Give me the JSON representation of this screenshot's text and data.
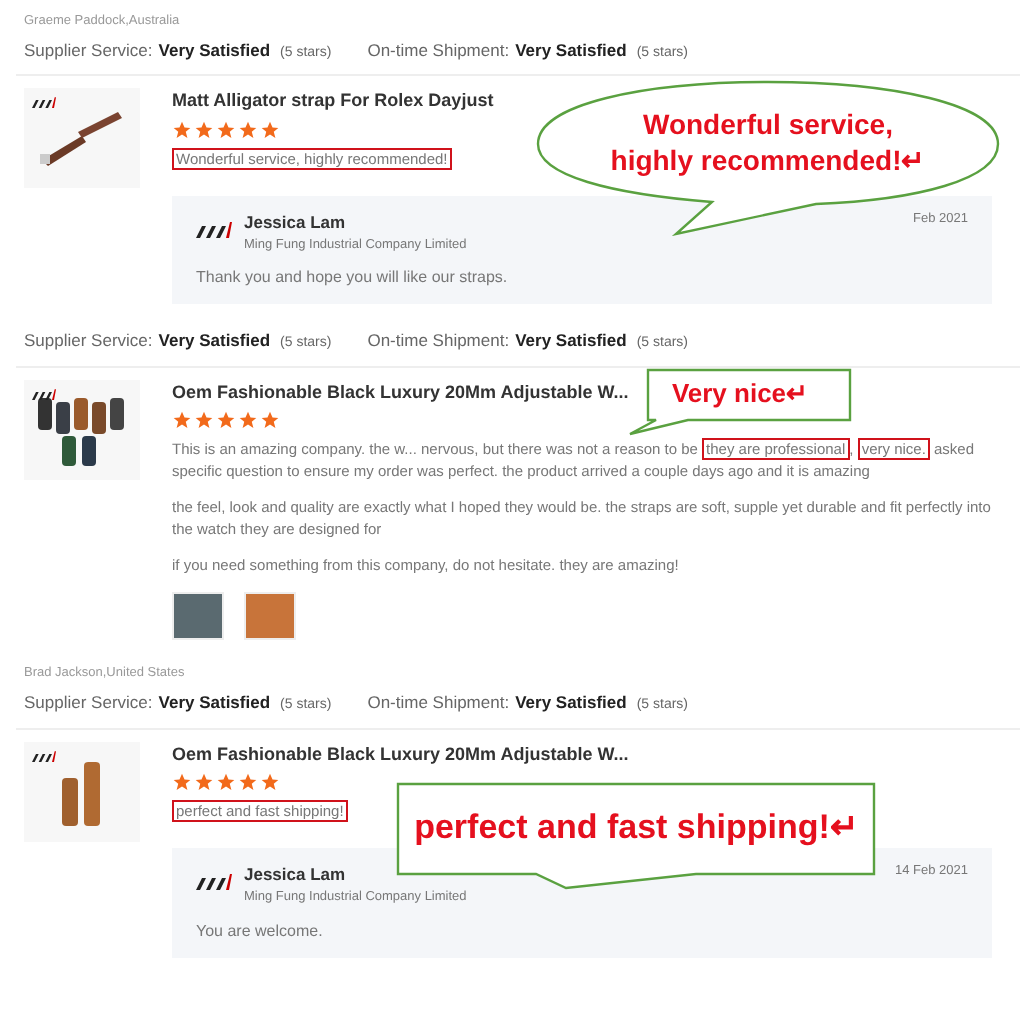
{
  "reviews": [
    {
      "reviewer": "Graeme Paddock,Australia",
      "ratings": [
        {
          "label": "Supplier Service:",
          "value": "Very Satisfied",
          "stars_text": "(5 stars)"
        },
        {
          "label": "On-time Shipment:",
          "value": "Very Satisfied",
          "stars_text": "(5 stars)"
        }
      ],
      "product": {
        "image": {
          "kind": "brown-strap"
        },
        "title": "Matt Alligator strap For Rolex Dayjust",
        "stars": 5,
        "comment": [
          [
            {
              "text": "Wonderful service, highly recommended!",
              "highlighted": true
            }
          ]
        ],
        "callout": {
          "kind": "ellipse",
          "lines": [
            "Wonderful service,",
            "highly recommended!↵"
          ]
        },
        "reply": {
          "name": "Jessica Lam",
          "company": "Ming Fung Industrial Company Limited",
          "date": "Feb 2021",
          "text": "Thank you and hope you will like our straps."
        }
      }
    },
    {
      "ratings": [
        {
          "label": "Supplier Service:",
          "value": "Very Satisfied",
          "stars_text": "(5 stars)"
        },
        {
          "label": "On-time Shipment:",
          "value": "Very Satisfied",
          "stars_text": "(5 stars)"
        }
      ],
      "product": {
        "image": {
          "kind": "strap-set"
        },
        "title": "Oem Fashionable Black Luxury 20Mm Adjustable W...",
        "stars": 5,
        "comment": [
          [
            {
              "text": "This is an amazing company. the w... nervous, but there was not a reason to be ",
              "highlighted": false
            },
            {
              "text": "they are professional",
              "highlighted": true
            },
            {
              "text": ", ",
              "highlighted": false
            },
            {
              "text": "very nice.",
              "highlighted": true
            },
            {
              "text": " asked specific question to ensure my order was perfect. the product arrived a couple days ago and it is amazing",
              "highlighted": false
            }
          ],
          [
            {
              "text": "the feel, look and quality are exactly what I hoped they would be. the straps are soft, supple yet durable and fit perfectly into the watch they are designed for",
              "highlighted": false
            }
          ],
          [
            {
              "text": "if you need something from this company, do not hesitate. they are amazing!",
              "highlighted": false
            }
          ]
        ],
        "photos": [
          {
            "kind": "watch"
          },
          {
            "kind": "strap"
          }
        ],
        "callout": {
          "kind": "box-tail-left",
          "lines": [
            "Very nice↵"
          ]
        }
      }
    },
    {
      "reviewer": "Brad Jackson,United States",
      "ratings": [
        {
          "label": "Supplier Service:",
          "value": "Very Satisfied",
          "stars_text": "(5 stars)"
        },
        {
          "label": "On-time Shipment:",
          "value": "Very Satisfied",
          "stars_text": "(5 stars)"
        }
      ],
      "product": {
        "image": {
          "kind": "tall-strap"
        },
        "title": "Oem Fashionable Black Luxury 20Mm Adjustable W...",
        "stars": 5,
        "comment": [
          [
            {
              "text": "perfect and fast shipping!",
              "highlighted": true
            }
          ]
        ],
        "callout": {
          "kind": "box-tail-down",
          "lines": [
            "perfect and fast shipping!↵"
          ]
        },
        "reply": {
          "name": "Jessica Lam",
          "company": "Ming Fung Industrial Company Limited",
          "date": "14 Feb 2021",
          "text": "You are welcome."
        }
      }
    }
  ]
}
